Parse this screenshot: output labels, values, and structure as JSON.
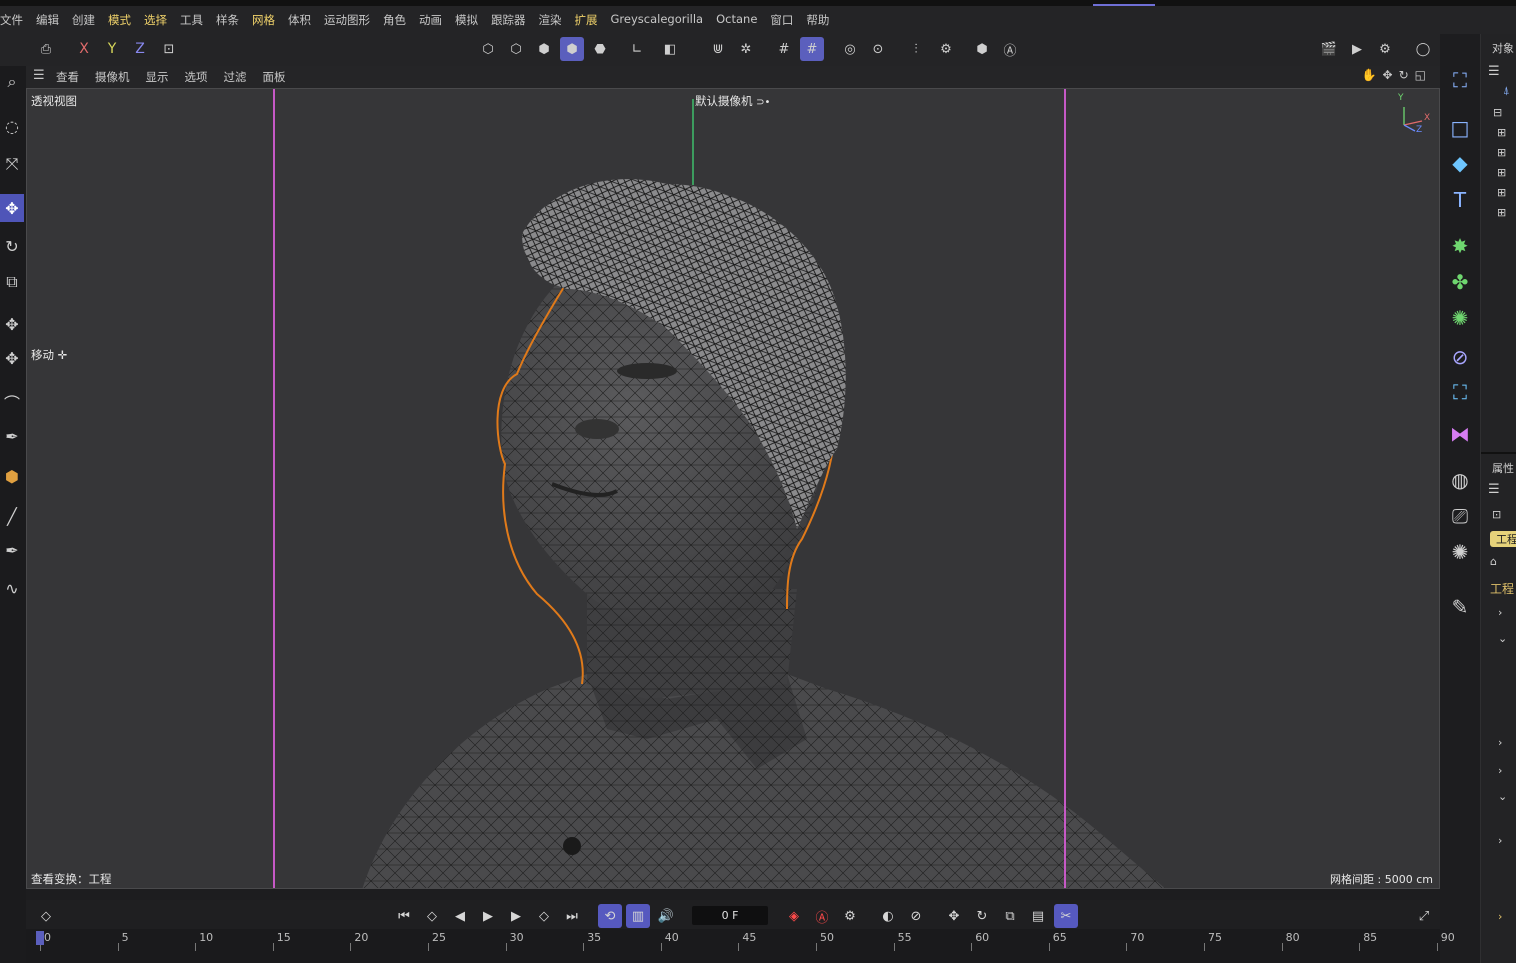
{
  "menu": [
    "文件",
    "编辑",
    "创建",
    "模式",
    "选择",
    "工具",
    "样条",
    "网格",
    "体积",
    "运动图形",
    "角色",
    "动画",
    "模拟",
    "跟踪器",
    "渲染",
    "扩展",
    "Greyscalegorilla",
    "Octane",
    "窗口",
    "帮助"
  ],
  "menu_highlight": [
    "模式",
    "选择",
    "网格",
    "扩展"
  ],
  "toolbar": {
    "x": "X",
    "y": "Y",
    "z": "Z"
  },
  "viewport_menu": [
    "查看",
    "摄像机",
    "显示",
    "选项",
    "过滤",
    "面板"
  ],
  "viewport": {
    "view_name": "透视视图",
    "camera_label": "默认摄像机",
    "camera_icon": "⊃•",
    "tool_label": "移动",
    "tool_icon": "✛",
    "status_left": "查看变换：工程",
    "grid_spacing": "网格间距 : 5000 cm",
    "axis_x": "X",
    "axis_y": "Y",
    "axis_z": "Z"
  },
  "right_panel": {
    "objects_title": "对象",
    "attributes_title": "属性",
    "project_tag": "工程",
    "project_label": "工程"
  },
  "timeline": {
    "frame_value": "0 F",
    "ruler": [
      "0",
      "5",
      "10",
      "15",
      "20",
      "25",
      "30",
      "35",
      "40",
      "45",
      "50",
      "55",
      "60",
      "65",
      "70",
      "75",
      "80",
      "85",
      "90"
    ]
  },
  "colors": {
    "accent": "#5b5fbd",
    "selection_outline": "#e07a1a",
    "safe_frame": "#c659c6",
    "menu_highlight": "#f0d26a"
  }
}
